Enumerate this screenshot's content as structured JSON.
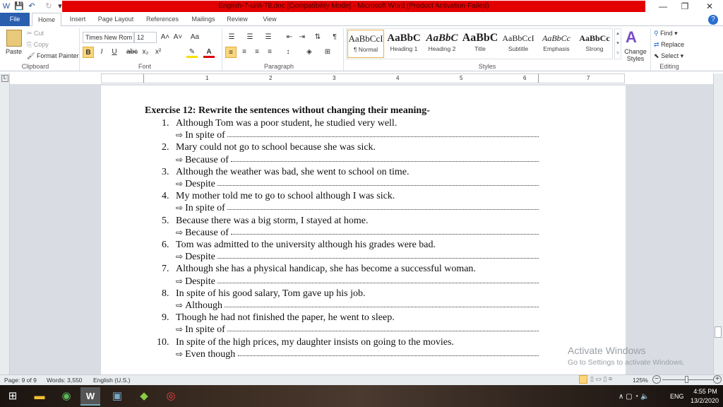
{
  "window": {
    "title": "English-7-unit-78.doc [Compatibility Mode]  -  Microsoft Word (Product Activation Failed)",
    "minimize": "—",
    "restore": "❐",
    "close": "✕"
  },
  "tabs": [
    "File",
    "Home",
    "Insert",
    "Page Layout",
    "References",
    "Mailings",
    "Review",
    "View"
  ],
  "clipboard": {
    "paste": "Paste",
    "cut": "Cut",
    "copy": "Copy",
    "format_painter": "Format Painter",
    "label": "Clipboard"
  },
  "font": {
    "name": "Times New Rom",
    "size": "12",
    "label": "Font",
    "bold": "B",
    "italic": "I",
    "underline": "U",
    "strike": "abc",
    "sub": "x₂",
    "sup": "x²",
    "grow": "A˄",
    "shrink": "A˅",
    "case": "Aa"
  },
  "paragraph": {
    "label": "Paragraph"
  },
  "styles": {
    "label": "Styles",
    "items": [
      {
        "preview": "AaBbCcI",
        "name": "¶ Normal"
      },
      {
        "preview": "AaBbC",
        "name": "Heading 1"
      },
      {
        "preview": "AaBbC",
        "name": "Heading 2"
      },
      {
        "preview": "AaBbC",
        "name": "Title"
      },
      {
        "preview": "AaBbCcI",
        "name": "Subtitle"
      },
      {
        "preview": "AaBbCc",
        "name": "Emphasis"
      },
      {
        "preview": "AaBbCc",
        "name": "Strong"
      }
    ],
    "change": "Change Styles"
  },
  "editing": {
    "label": "Editing",
    "find": "Find",
    "replace": "Replace",
    "select": "Select"
  },
  "ruler": [
    "1",
    "2",
    "3",
    "4",
    "5",
    "6",
    "7"
  ],
  "document": {
    "heading": "Exercise 12: Rewrite the sentences without  changing  their meaning-",
    "items": [
      {
        "n": "1.",
        "s": "Although Tom was a poor student, he studied very well.",
        "p": "In spite of"
      },
      {
        "n": "2.",
        "s": "Mary could not go to school because she was sick.",
        "p": "Because of"
      },
      {
        "n": "3.",
        "s": "Although the weather was bad, she went to school on time.",
        "p": "Despite"
      },
      {
        "n": "4.",
        "s": "My mother told me to go to school although I was sick.",
        "p": "In spite of"
      },
      {
        "n": "5.",
        "s": "Because there was a big storm, I stayed at home.",
        "p": "Because of"
      },
      {
        "n": "6.",
        "s": "Tom was admitted to the university although his grades were bad.",
        "p": "Despite"
      },
      {
        "n": "7.",
        "s": "Although she has a physical handicap, she has become a successful woman.",
        "p": "Despite"
      },
      {
        "n": "8.",
        "s": "In spite of his good salary, Tom gave up his job.",
        "p": "Although"
      },
      {
        "n": "9.",
        "s": "Though he had not finished the paper, he went to sleep.",
        "p": "In spite of"
      },
      {
        "n": "10.",
        "s": "In spite of the high prices, my daughter insists on going to the movies.",
        "p": "Even though"
      }
    ]
  },
  "watermark": {
    "title": "Activate Windows",
    "sub": "Go to Settings to activate Windows."
  },
  "status": {
    "page": "Page: 9 of 9",
    "words": "Words: 3,550",
    "lang": "English (U.S.)",
    "zoom": "125%"
  },
  "taskbar": {
    "lang": "ENG",
    "time": "4:55 PM",
    "date": "13/2/2020"
  }
}
